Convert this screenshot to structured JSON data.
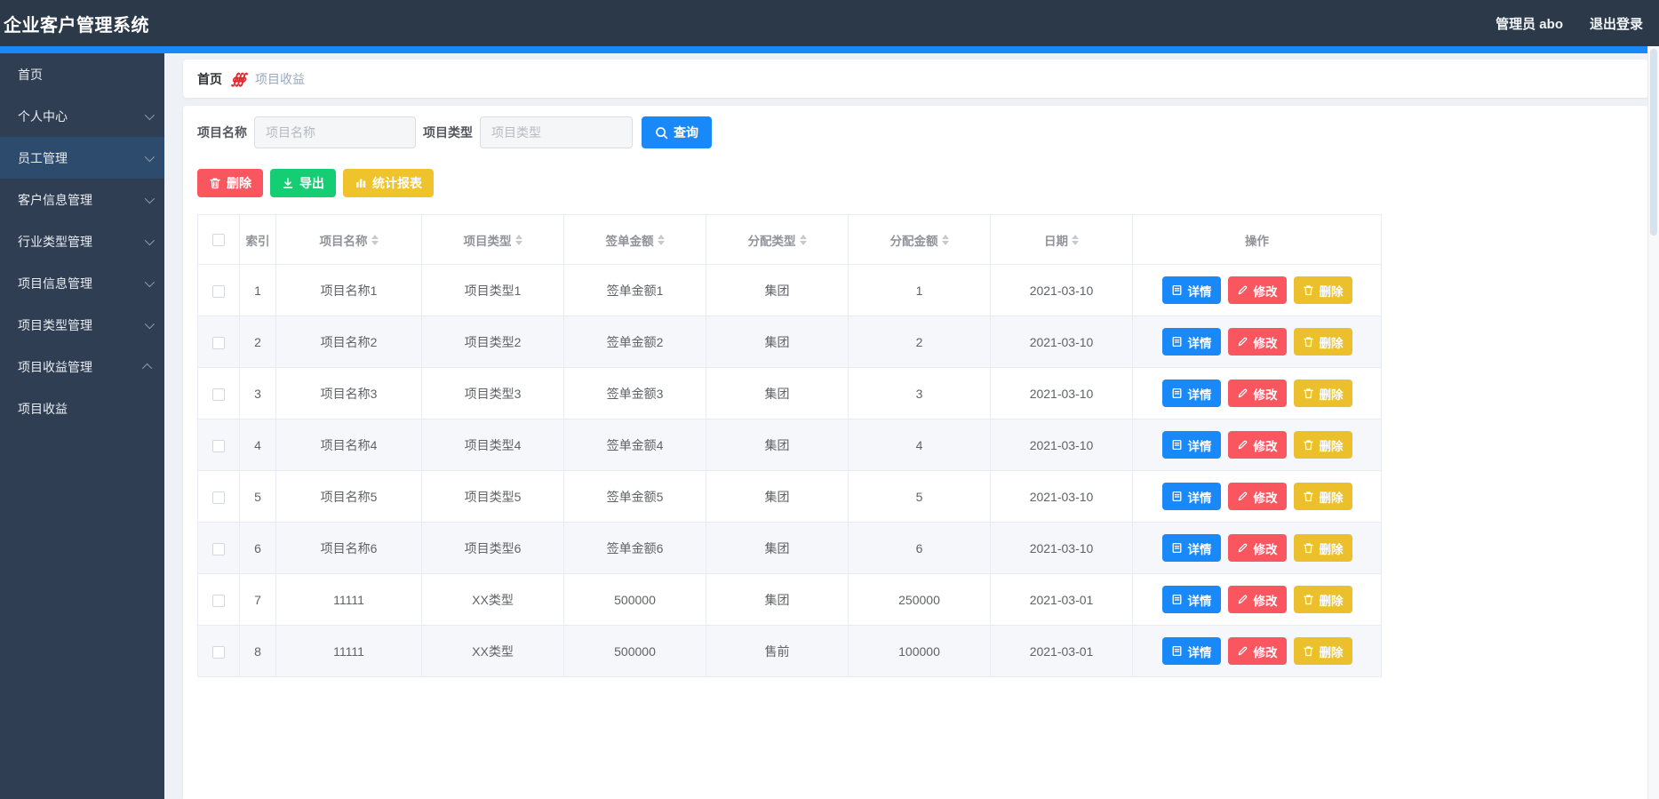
{
  "app": {
    "title": "企业客户管理系统",
    "user": "管理员 abo",
    "logout": "退出登录"
  },
  "sidebar": {
    "items": [
      {
        "label": "首页",
        "chevron": "none",
        "active": false
      },
      {
        "label": "个人中心",
        "chevron": "down",
        "active": false
      },
      {
        "label": "员工管理",
        "chevron": "down",
        "active": true
      },
      {
        "label": "客户信息管理",
        "chevron": "down",
        "active": false
      },
      {
        "label": "行业类型管理",
        "chevron": "down",
        "active": false
      },
      {
        "label": "项目信息管理",
        "chevron": "down",
        "active": false
      },
      {
        "label": "项目类型管理",
        "chevron": "down",
        "active": false
      },
      {
        "label": "项目收益管理",
        "chevron": "up",
        "active": false
      },
      {
        "label": "项目收益",
        "chevron": "none",
        "active": false
      }
    ]
  },
  "breadcrumb": {
    "home": "首页",
    "separator_glyph": "∮∮∮",
    "current": "项目收益"
  },
  "filters": {
    "name_label": "项目名称",
    "name_placeholder": "项目名称",
    "type_label": "项目类型",
    "type_placeholder": "项目类型",
    "search_label": "查询"
  },
  "actions": {
    "delete_label": "删除",
    "export_label": "导出",
    "report_label": "统计报表"
  },
  "table": {
    "headers": {
      "index": "索引",
      "name": "项目名称",
      "type": "项目类型",
      "sign_amount": "签单金额",
      "alloc_type": "分配类型",
      "alloc_amount": "分配金额",
      "date": "日期",
      "ops": "操作"
    },
    "row_actions": {
      "detail": "详情",
      "edit": "修改",
      "delete": "删除"
    },
    "rows": [
      {
        "index": "1",
        "name": "项目名称1",
        "type": "项目类型1",
        "sign_amount": "签单金额1",
        "alloc_type": "集团",
        "alloc_amount": "1",
        "date": "2021-03-10"
      },
      {
        "index": "2",
        "name": "项目名称2",
        "type": "项目类型2",
        "sign_amount": "签单金额2",
        "alloc_type": "集团",
        "alloc_amount": "2",
        "date": "2021-03-10"
      },
      {
        "index": "3",
        "name": "项目名称3",
        "type": "项目类型3",
        "sign_amount": "签单金额3",
        "alloc_type": "集团",
        "alloc_amount": "3",
        "date": "2021-03-10"
      },
      {
        "index": "4",
        "name": "项目名称4",
        "type": "项目类型4",
        "sign_amount": "签单金额4",
        "alloc_type": "集团",
        "alloc_amount": "4",
        "date": "2021-03-10"
      },
      {
        "index": "5",
        "name": "项目名称5",
        "type": "项目类型5",
        "sign_amount": "签单金额5",
        "alloc_type": "集团",
        "alloc_amount": "5",
        "date": "2021-03-10"
      },
      {
        "index": "6",
        "name": "项目名称6",
        "type": "项目类型6",
        "sign_amount": "签单金额6",
        "alloc_type": "集团",
        "alloc_amount": "6",
        "date": "2021-03-10"
      },
      {
        "index": "7",
        "name": "11111",
        "type": "XX类型",
        "sign_amount": "500000",
        "alloc_type": "集团",
        "alloc_amount": "250000",
        "date": "2021-03-01"
      },
      {
        "index": "8",
        "name": "11111",
        "type": "XX类型",
        "sign_amount": "500000",
        "alloc_type": "售前",
        "alloc_amount": "100000",
        "date": "2021-03-01"
      }
    ]
  },
  "colors": {
    "navbar": "#2c3949",
    "sidebar": "#2f3e53",
    "sidebar_active": "#2d4b6c",
    "accent_blue": "#1989fa",
    "danger_red": "#f9565f",
    "success_green": "#15cd72",
    "warning_yellow": "#eec32b",
    "breadcrumb_sep_red": "#e8262d"
  }
}
